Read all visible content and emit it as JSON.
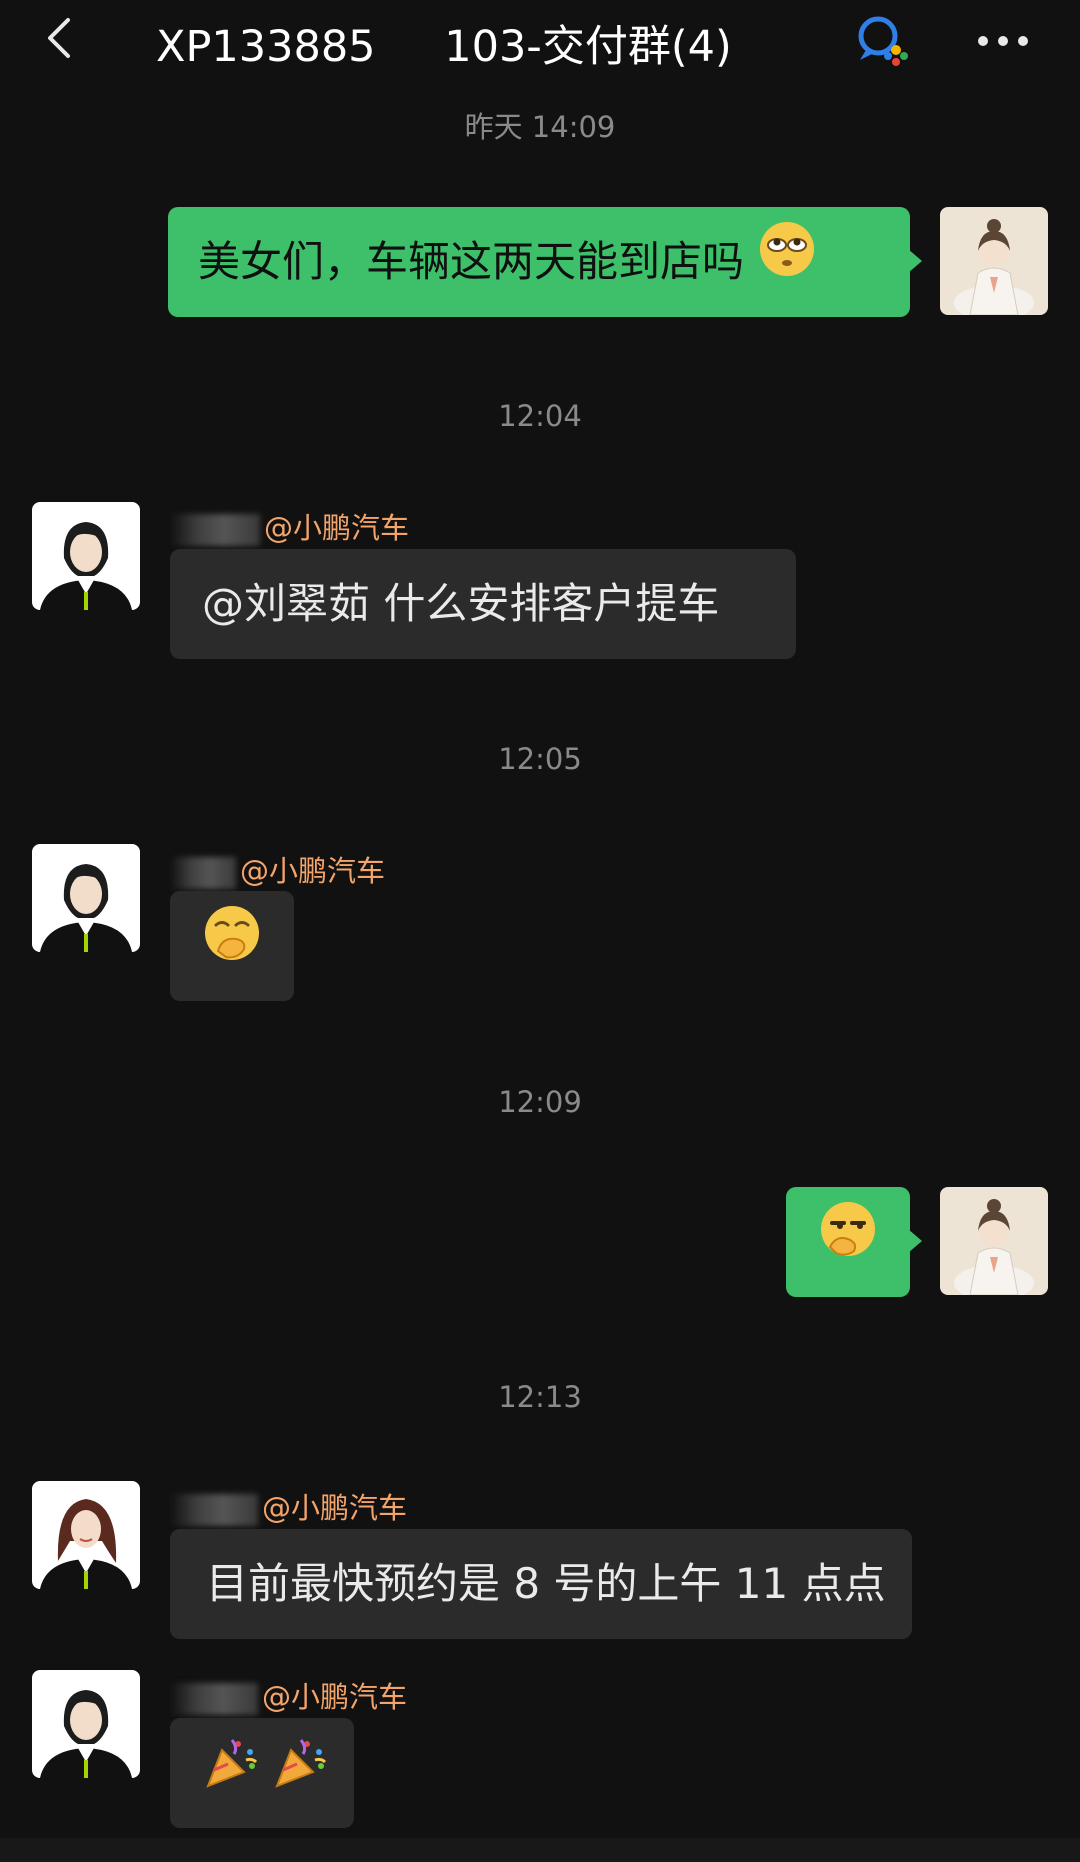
{
  "header": {
    "title": "XP133885        103-交付群(4)",
    "title_icon": "wecom-chat-icon",
    "back_icon": "chevron-left-icon",
    "more_icon": "more-dots-icon"
  },
  "colors": {
    "background": "#111111",
    "outgoing_bubble": "#3ec06b",
    "incoming_bubble": "#2b2b2b",
    "sender_name": "#f2a46a",
    "timestamp": "#8a8a8a"
  },
  "messages": [
    {
      "type": "time",
      "text": "昨天 14:09"
    },
    {
      "type": "outgoing",
      "text": "美女们，车辆这两天能到店吗",
      "emoji": "rolling-eyes-emoji"
    },
    {
      "type": "time",
      "text": "12:04"
    },
    {
      "type": "incoming",
      "sender": "@小鹏汽车",
      "text": "@刘翠茹 什么安排客户提车"
    },
    {
      "type": "time",
      "text": "12:05"
    },
    {
      "type": "incoming",
      "sender": "@小鹏汽车",
      "emoji": "hand-over-mouth-emoji"
    },
    {
      "type": "time",
      "text": "12:09"
    },
    {
      "type": "outgoing",
      "emoji": "smirk-hand-emoji"
    },
    {
      "type": "time",
      "text": "12:13"
    },
    {
      "type": "incoming",
      "sender": "@小鹏汽车",
      "text": "目前最快预约是 8 号的上午 11 点点"
    },
    {
      "type": "incoming",
      "sender": "@小鹏汽车",
      "emoji": "party-popper-emoji x2"
    }
  ]
}
